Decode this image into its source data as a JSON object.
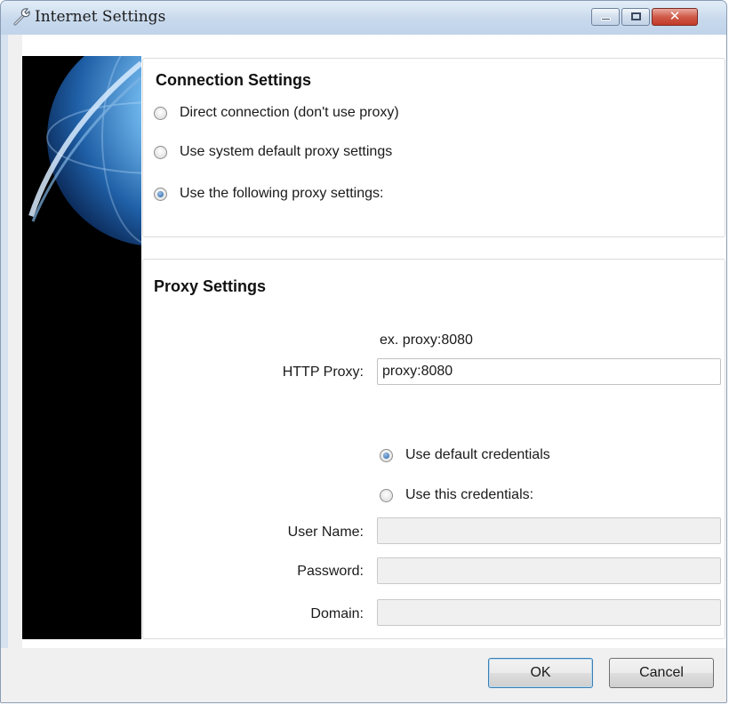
{
  "window": {
    "title": "Internet Settings",
    "icons": {
      "app": "wrench-icon",
      "minimize": "minimize-icon",
      "maximize": "maximize-icon",
      "close": "close-icon"
    },
    "close_glyph": "✕"
  },
  "connection_settings": {
    "title": "Connection Settings",
    "options": [
      {
        "label": "Direct connection (don't use proxy)",
        "checked": false
      },
      {
        "label": "Use system default proxy settings",
        "checked": false
      },
      {
        "label": "Use the following proxy settings:",
        "checked": true
      }
    ]
  },
  "proxy_settings": {
    "title": "Proxy Settings",
    "http_proxy_hint": "ex. proxy:8080",
    "http_proxy_label": "HTTP Proxy:",
    "http_proxy_value": "proxy:8080",
    "credentials_options": [
      {
        "label": "Use default credentials",
        "checked": true
      },
      {
        "label": "Use this credentials:",
        "checked": false
      }
    ],
    "user_name_label": "User Name:",
    "user_name_value": "",
    "password_label": "Password:",
    "password_value": "",
    "domain_label": "Domain:",
    "domain_value": ""
  },
  "buttons": {
    "ok": "OK",
    "cancel": "Cancel"
  },
  "colors": {
    "title_bar": "#c8d9ec",
    "close_button": "#c13b28",
    "radio_checked": "#1d5fa6"
  }
}
